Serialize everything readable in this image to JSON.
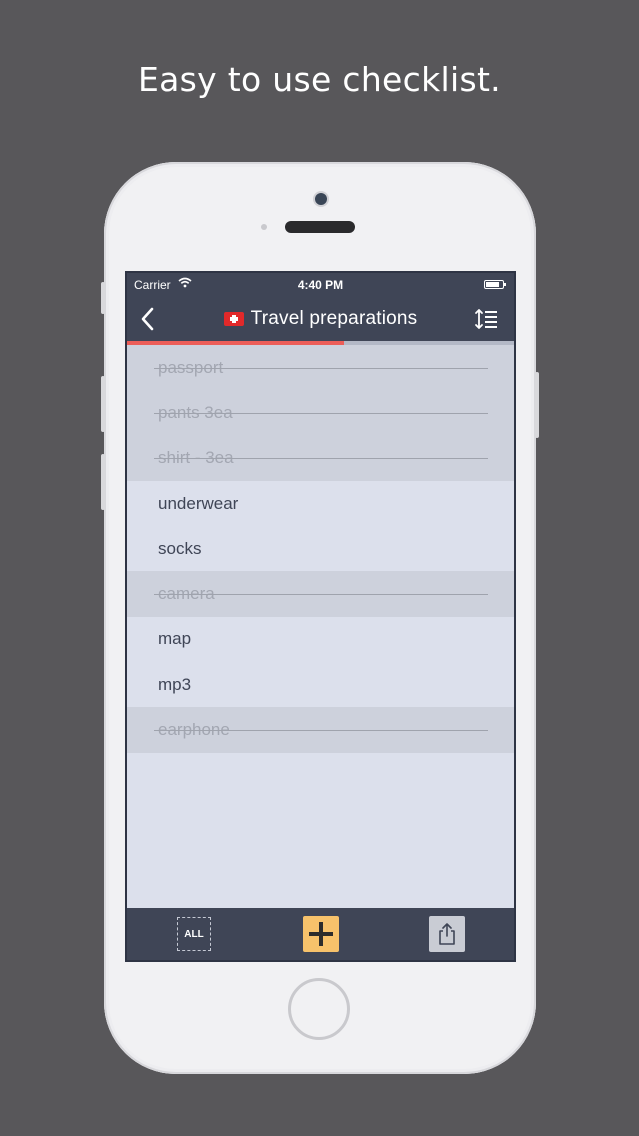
{
  "caption": "Easy to use checklist.",
  "status_bar": {
    "carrier": "Carrier",
    "time": "4:40 PM"
  },
  "nav": {
    "title": "Travel preparations",
    "flag_icon": "swiss-flag-icon"
  },
  "progress": {
    "completed_fraction": 0.56,
    "color": "#ec5d58"
  },
  "items": [
    {
      "label": "passport",
      "checked": true
    },
    {
      "label": "pants 3ea",
      "checked": true
    },
    {
      "label": "shirt - 3ea",
      "checked": true
    },
    {
      "label": "underwear",
      "checked": false
    },
    {
      "label": "socks",
      "checked": false
    },
    {
      "label": "camera",
      "checked": true
    },
    {
      "label": "map",
      "checked": false
    },
    {
      "label": "mp3",
      "checked": false
    },
    {
      "label": "earphone",
      "checked": true
    }
  ],
  "toolbar": {
    "all_label": "ALL",
    "add_color": "#f7c26b"
  },
  "colors": {
    "background": "#58575a",
    "navbar": "#3f4556",
    "list_bg": "#dce0ec",
    "checked_row": "#cdd1dc"
  }
}
